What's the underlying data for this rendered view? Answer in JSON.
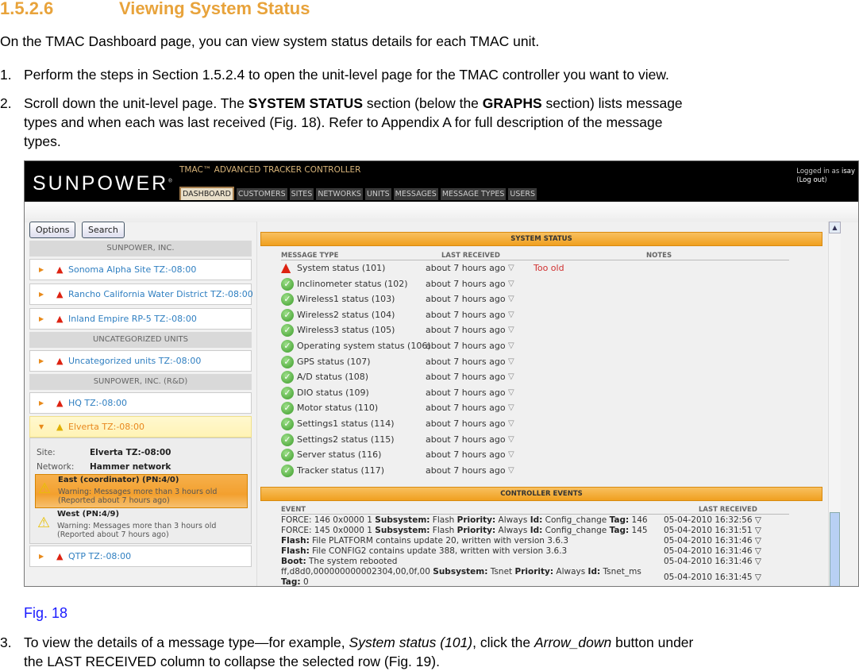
{
  "heading": {
    "number": "1.5.2.6",
    "title": "Viewing System Status"
  },
  "intro": "On the TMAC Dashboard page, you can view system status details for each TMAC unit.",
  "steps": [
    {
      "num": "1.",
      "text": "Perform the steps in Section 1.5.2.4 to open the unit-level page for the TMAC controller you want to view."
    },
    {
      "num": "2.",
      "pre": "Scroll down the unit-level page. The ",
      "b1": "SYSTEM STATUS",
      "mid": " section (below the ",
      "b2": "GRAPHS",
      "post": " section) lists message",
      "line2": "types and when each was last received (Fig. 18). Refer to Appendix A for full description of the message",
      "line3": "types."
    },
    {
      "num": "3.",
      "pre": "To view the details of a message type—for example, ",
      "i1": "System status (101)",
      "mid": ", click the ",
      "i2": "Arrow_down",
      "post": " button under",
      "line2": "the LAST RECEIVED column to collapse the selected row (Fig. 19)."
    }
  ],
  "caption": "Fig. 18",
  "app": {
    "logo": "SUNPOWER",
    "title": "TMAC™ ADVANCED TRACKER CONTROLLER",
    "tabs": [
      "DASHBOARD",
      "CUSTOMERS",
      "SITES",
      "NETWORKS",
      "UNITS",
      "MESSAGES",
      "MESSAGE TYPES",
      "USERS"
    ],
    "active_tab": "DASHBOARD",
    "login": {
      "prefix": "Logged in as",
      "user": "isay",
      "logout": "Log out"
    },
    "buttons": {
      "options": "Options",
      "search": "Search"
    },
    "sidebar": {
      "groups": [
        "SUNPOWER, INC.",
        "UNCATEGORIZED UNITS",
        "SUNPOWER, INC. (R&D)"
      ],
      "items": [
        "Sonoma Alpha Site TZ:-08:00",
        "Rancho California Water District TZ:-08:00",
        "Inland Empire RP-5 TZ:-08:00",
        "Uncategorized units TZ:-08:00",
        "HQ TZ:-08:00",
        "Elverta TZ:-08:00",
        "QTP TZ:-08:00"
      ],
      "details": {
        "site_label": "Site:",
        "site": "Elverta TZ:-08:00",
        "network_label": "Network:",
        "network": "Hammer network",
        "units": [
          {
            "name": "East (coordinator) (PN:4/0)",
            "warning": "Warning: Messages more than 3 hours old",
            "reported": "(Reported about 7 hours ago)"
          },
          {
            "name": "West (PN:4/9)",
            "warning": "Warning: Messages more than 3 hours old",
            "reported": "(Reported about 7 hours ago)"
          }
        ]
      }
    },
    "system_status": {
      "title": "SYSTEM STATUS",
      "columns": [
        "MESSAGE TYPE",
        "LAST RECEIVED",
        "NOTES"
      ],
      "rows": [
        {
          "type": "System status (101)",
          "last": "about 7 hours ago",
          "note": "Too old",
          "status": "error"
        },
        {
          "type": "Inclinometer status (102)",
          "last": "about 7 hours ago",
          "note": "",
          "status": "ok"
        },
        {
          "type": "Wireless1 status (103)",
          "last": "about 7 hours ago",
          "note": "",
          "status": "ok"
        },
        {
          "type": "Wireless2 status (104)",
          "last": "about 7 hours ago",
          "note": "",
          "status": "ok"
        },
        {
          "type": "Wireless3 status (105)",
          "last": "about 7 hours ago",
          "note": "",
          "status": "ok"
        },
        {
          "type": "Operating system status (106)",
          "last": "about 7 hours ago",
          "note": "",
          "status": "ok"
        },
        {
          "type": "GPS status (107)",
          "last": "about 7 hours ago",
          "note": "",
          "status": "ok"
        },
        {
          "type": "A/D status (108)",
          "last": "about 7 hours ago",
          "note": "",
          "status": "ok"
        },
        {
          "type": "DIO status (109)",
          "last": "about 7 hours ago",
          "note": "",
          "status": "ok"
        },
        {
          "type": "Motor status (110)",
          "last": "about 7 hours ago",
          "note": "",
          "status": "ok"
        },
        {
          "type": "Settings1 status (114)",
          "last": "about 7 hours ago",
          "note": "",
          "status": "ok"
        },
        {
          "type": "Settings2 status (115)",
          "last": "about 7 hours ago",
          "note": "",
          "status": "ok"
        },
        {
          "type": "Server status (116)",
          "last": "about 7 hours ago",
          "note": "",
          "status": "ok"
        },
        {
          "type": "Tracker status (117)",
          "last": "about 7 hours ago",
          "note": "",
          "status": "ok"
        }
      ]
    },
    "controller_events": {
      "title": "CONTROLLER EVENTS",
      "columns": [
        "EVENT",
        "LAST RECEIVED"
      ],
      "rows": [
        {
          "html": "FORCE: 146 0x0000 1 <b>Subsystem:</b> Flash <b>Priority:</b> Always <b>Id:</b> Config_change <b>Tag:</b> 146",
          "last": "05-04-2010 16:32:56"
        },
        {
          "html": "FORCE: 145 0x0000 1 <b>Subsystem:</b> Flash <b>Priority:</b> Always <b>Id:</b> Config_change <b>Tag:</b> 145",
          "last": "05-04-2010 16:31:51"
        },
        {
          "html": "<b>Flash:</b> File PLATFORM contains update 20, written with version 3.6.3",
          "last": "05-04-2010 16:31:46"
        },
        {
          "html": "<b>Flash:</b> File CONFIG2 contains update 388, written with version 3.6.3",
          "last": "05-04-2010 16:31:46"
        },
        {
          "html": "<b>Boot:</b> The system rebooted",
          "last": "05-04-2010 16:31:46"
        },
        {
          "html": "ff,d8d0,000000000002304,00,0f,00 <b>Subsystem:</b> Tsnet <b>Priority:</b> Always <b>Id:</b> Tsnet_ms <b>Tag:</b> 0",
          "last": "05-04-2010 16:31:45"
        }
      ]
    },
    "colors": {
      "heading": "#e8a33b",
      "caption": "#1a1aff",
      "bar": "#f0a020",
      "link": "#2f7fc1",
      "error": "#d03030"
    }
  }
}
